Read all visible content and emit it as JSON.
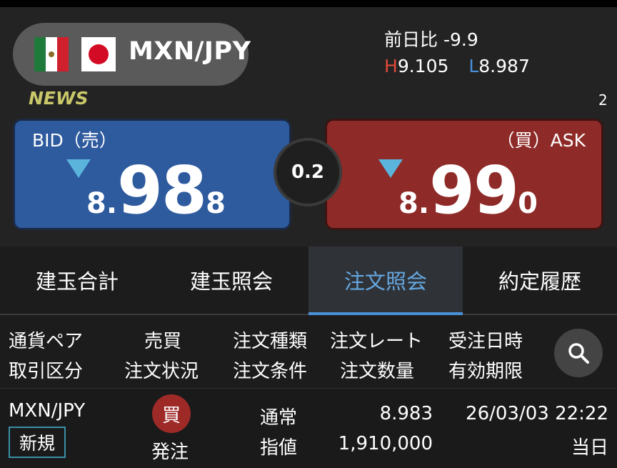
{
  "pair": {
    "name": "MXN/JPY",
    "flag1": "mexico-flag",
    "flag2": "japan-flag"
  },
  "stats": {
    "prev_label": "前日比",
    "prev_value": "-9.9",
    "high_label": "H",
    "high_value": "9.105",
    "low_label": "L",
    "low_value": "8.987"
  },
  "news": {
    "label": "NEWS",
    "ticker_edge": "2"
  },
  "bid": {
    "label": "BID（売）",
    "p1": "8.",
    "p2": "98",
    "p3": "8",
    "direction": "down-triangle-icon"
  },
  "ask": {
    "label": "（買）ASK",
    "p1": "8.",
    "p2": "99",
    "p3": "0",
    "direction": "down-triangle-icon"
  },
  "spread": "0.2",
  "tabs": [
    {
      "label": "建玉合計"
    },
    {
      "label": "建玉照会"
    },
    {
      "label": "注文照会",
      "active": true
    },
    {
      "label": "約定履歴"
    }
  ],
  "columns": {
    "c1a": "通貨ペア",
    "c1b": "取引区分",
    "c2a": "売買",
    "c2b": "注文状況",
    "c3a": "注文種類",
    "c3b": "注文条件",
    "c4a": "注文レート",
    "c4b": "注文数量",
    "c5a": "受注日時",
    "c5b": "有効期限"
  },
  "orders": [
    {
      "pair": "MXN/JPY",
      "type_badge": "新規",
      "side": "買",
      "status": "発注",
      "order_kind": "通常",
      "condition": "指値",
      "rate": "8.983",
      "quantity": "1,910,000",
      "datetime": "26/03/03 22:22",
      "expiry": "当日"
    }
  ],
  "colors": {
    "bid": "#2e5a9e",
    "ask": "#8e2b28",
    "accent": "#4a90d9",
    "high": "#e0483a",
    "news": "#c9c76a"
  }
}
